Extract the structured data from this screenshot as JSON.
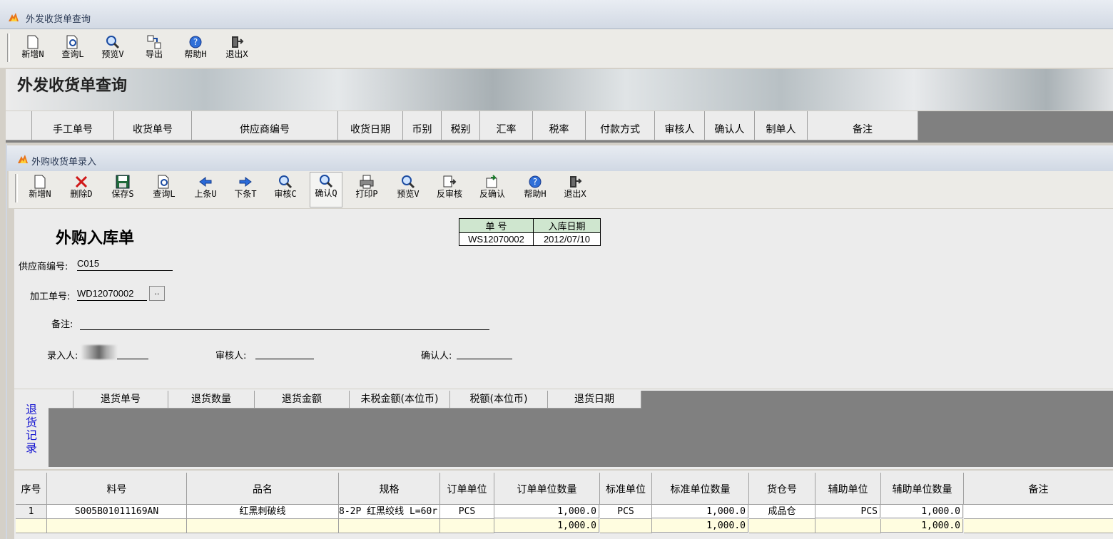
{
  "outer": {
    "title": "外发收货单查询",
    "toolbar": [
      {
        "icon": "new-doc-icon",
        "label": "新增N"
      },
      {
        "icon": "query-icon",
        "label": "查询L"
      },
      {
        "icon": "preview-icon",
        "label": "预览V"
      },
      {
        "icon": "export-icon",
        "label": "导出"
      },
      {
        "icon": "help-icon",
        "label": "帮助H"
      },
      {
        "icon": "exit-icon",
        "label": "退出X"
      }
    ],
    "banner_title": "外发收货单查询",
    "grid_columns": [
      "手工单号",
      "收货单号",
      "供应商编号",
      "收货日期",
      "币别",
      "税别",
      "汇率",
      "税率",
      "付款方式",
      "审核人",
      "确认人",
      "制单人",
      "备注"
    ]
  },
  "inner": {
    "title": "外购收货单录入",
    "toolbar": [
      {
        "icon": "new-doc-icon",
        "label": "新增N"
      },
      {
        "icon": "delete-icon",
        "label": "删除D"
      },
      {
        "icon": "save-icon",
        "label": "保存S"
      },
      {
        "icon": "query-icon",
        "label": "查询L"
      },
      {
        "icon": "arrow-left-icon",
        "label": "上条U"
      },
      {
        "icon": "arrow-right-icon",
        "label": "下条T"
      },
      {
        "icon": "audit-icon",
        "label": "审核C"
      },
      {
        "icon": "confirm-icon",
        "label": "确认Q"
      },
      {
        "icon": "print-icon",
        "label": "打印P"
      },
      {
        "icon": "preview-icon",
        "label": "预览V"
      },
      {
        "icon": "unaudit-icon",
        "label": "反审核"
      },
      {
        "icon": "unconfirm-icon",
        "label": "反确认"
      },
      {
        "icon": "help-icon",
        "label": "帮助H"
      },
      {
        "icon": "exit-icon",
        "label": "退出X"
      }
    ],
    "form": {
      "heading": "外购入库单",
      "doc_no_label": "单  号",
      "doc_no": "WS12070002",
      "date_label": "入库日期",
      "date": "2012/07/10",
      "supplier_label": "供应商编号:",
      "supplier": "C015",
      "process_no_label": "加工单号:",
      "process_no": "WD12070002",
      "browse_label": "..",
      "remark_label": "备注:",
      "remark": "",
      "entered_by_label": "录入人:",
      "reviewer_label": "审核人:",
      "confirmer_label": "确认人:"
    },
    "return_records": {
      "label": "退货记录",
      "columns": [
        "退货单号",
        "退货数量",
        "退货金额",
        "未税金额(本位币)",
        "税额(本位币)",
        "退货日期"
      ]
    },
    "items": {
      "columns": [
        "序号",
        "料号",
        "品名",
        "规格",
        "订单单位",
        "订单单位数量",
        "标准单位",
        "标准单位数量",
        "货仓号",
        "辅助单位",
        "辅助单位数量",
        "备注"
      ],
      "rows": [
        {
          "seq": "1",
          "part_no": "S005B01011169AN",
          "name": "红黑刺破线",
          "spec": "8-2P 红黑绞线 L=60r",
          "order_unit": "PCS",
          "order_qty": "1,000.0",
          "std_unit": "PCS",
          "std_qty": "1,000.0",
          "warehouse": "成品仓",
          "aux_unit": "PCS",
          "aux_qty": "1,000.0",
          "remark": ""
        },
        {
          "seq": "",
          "part_no": "",
          "name": "",
          "spec": "",
          "order_unit": "",
          "order_qty": "1,000.0",
          "std_unit": "",
          "std_qty": "1,000.0",
          "warehouse": "",
          "aux_unit": "",
          "aux_qty": "1,000.0",
          "remark": ""
        }
      ]
    }
  }
}
